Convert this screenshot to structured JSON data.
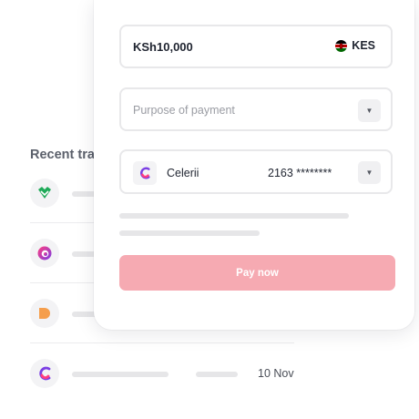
{
  "recent": {
    "title": "Recent transactions",
    "items": [
      {
        "logo": "green-heart-logo",
        "date": ""
      },
      {
        "logo": "swirl-logo",
        "date": ""
      },
      {
        "logo": "orange-d-logo",
        "date": ""
      },
      {
        "logo": "celerii-logo",
        "date": "10 Nov"
      }
    ]
  },
  "payment": {
    "amount": "KSh10,000",
    "currency": "KES",
    "currency_flag": "kenya-flag-icon",
    "purpose_placeholder": "Purpose of payment",
    "method_name": "Celerii",
    "method_card": "2163 ********",
    "pay_label": "Pay now"
  },
  "colors": {
    "pay_button": "#f6aab2",
    "celerii_purple": "#7b3fe4",
    "celerii_pink": "#ff3d7f",
    "green_logo": "#1faa59",
    "orange_logo": "#f59e4c"
  }
}
